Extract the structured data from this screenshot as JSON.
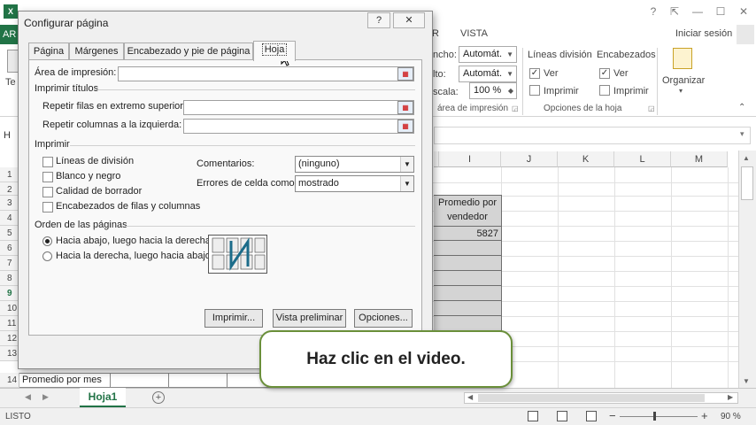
{
  "excel": {
    "file_tab": "AR",
    "view_tab": "VISTA",
    "r_tab": "R",
    "sign_in": "Iniciar sesión",
    "help": "?",
    "left_label_te": "Te",
    "width_label": "ncho:",
    "height_label": "lto:",
    "scale_label": "scala:",
    "width_value": "Automát.",
    "height_value": "Automát.",
    "scale_value": "100 %",
    "print_area_group": "área de impresión",
    "gridlines_header": "Líneas división",
    "headings_header": "Encabezados",
    "view_label": "Ver",
    "print_label": "Imprimir",
    "sheet_options_group": "Opciones de la hoja",
    "arrange_label": "Organizar",
    "name_box_fragment": "H",
    "columns": [
      "I",
      "J",
      "K",
      "L",
      "M"
    ],
    "rows": [
      "1",
      "2",
      "3",
      "4",
      "5",
      "6",
      "7",
      "8",
      "9",
      "10",
      "11",
      "12",
      "13",
      "14"
    ],
    "cell_header_line1": "Promedio por",
    "cell_header_line2": "vendedor",
    "cell_value": "5827",
    "row14_label": "Promedio por mes",
    "sheet_tab": "Hoja1",
    "status": "LISTO",
    "zoom": "90 %"
  },
  "dialog": {
    "title": "Configurar página",
    "help_button": "?",
    "tabs": [
      "Página",
      "Márgenes",
      "Encabezado y pie de página",
      "Hoja"
    ],
    "active_tab": "Hoja",
    "print_area_label": "Área de impresión:",
    "print_titles_section": "Imprimir títulos",
    "repeat_rows_label": "Repetir filas en extremo superior:",
    "repeat_cols_label": "Repetir columnas a la izquierda:",
    "print_section": "Imprimir",
    "options": [
      "Líneas de división",
      "Blanco y negro",
      "Calidad de borrador",
      "Encabezados de filas y columnas"
    ],
    "comments_label": "Comentarios:",
    "comments_value": "(ninguno)",
    "errors_label": "Errores de celda como:",
    "errors_value": "mostrado",
    "page_order_section": "Orden de las páginas",
    "order_down": "Hacia abajo, luego hacia la derecha",
    "order_over": "Hacia la derecha, luego hacia abajo",
    "print_button": "Imprimir...",
    "preview_button": "Vista preliminar",
    "options_button": "Opciones..."
  },
  "callout": {
    "text": "Haz clic en el video."
  }
}
